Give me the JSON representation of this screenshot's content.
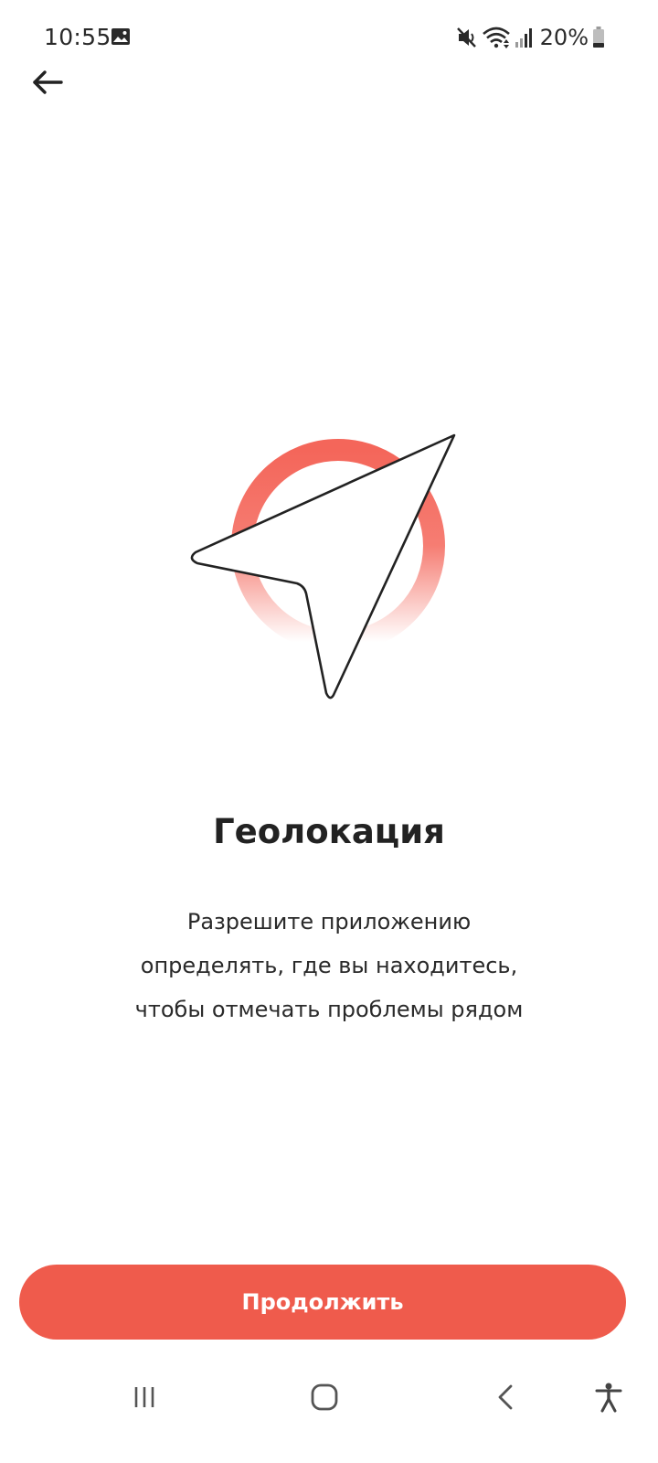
{
  "status_bar": {
    "time": "10:55",
    "battery_text": "20%",
    "icons": [
      "image-icon",
      "mute-icon",
      "wifi-icon",
      "signal-icon",
      "battery-icon"
    ]
  },
  "toolbar": {
    "back_icon": "arrow-left-icon"
  },
  "content": {
    "illustration": "location-arrow-icon",
    "title": "Геолокация",
    "description": "Разрешите приложению\nопределять, где вы находитесь,\nчтобы отмечать проблемы рядом"
  },
  "actions": {
    "continue_label": "Продолжить"
  },
  "nav_bar": {
    "icons": [
      "recent-apps-icon",
      "home-icon",
      "back-icon",
      "accessibility-icon"
    ]
  },
  "colors": {
    "accent": "#ef5b4c",
    "ring": "#f4665a",
    "text": "#222222"
  }
}
